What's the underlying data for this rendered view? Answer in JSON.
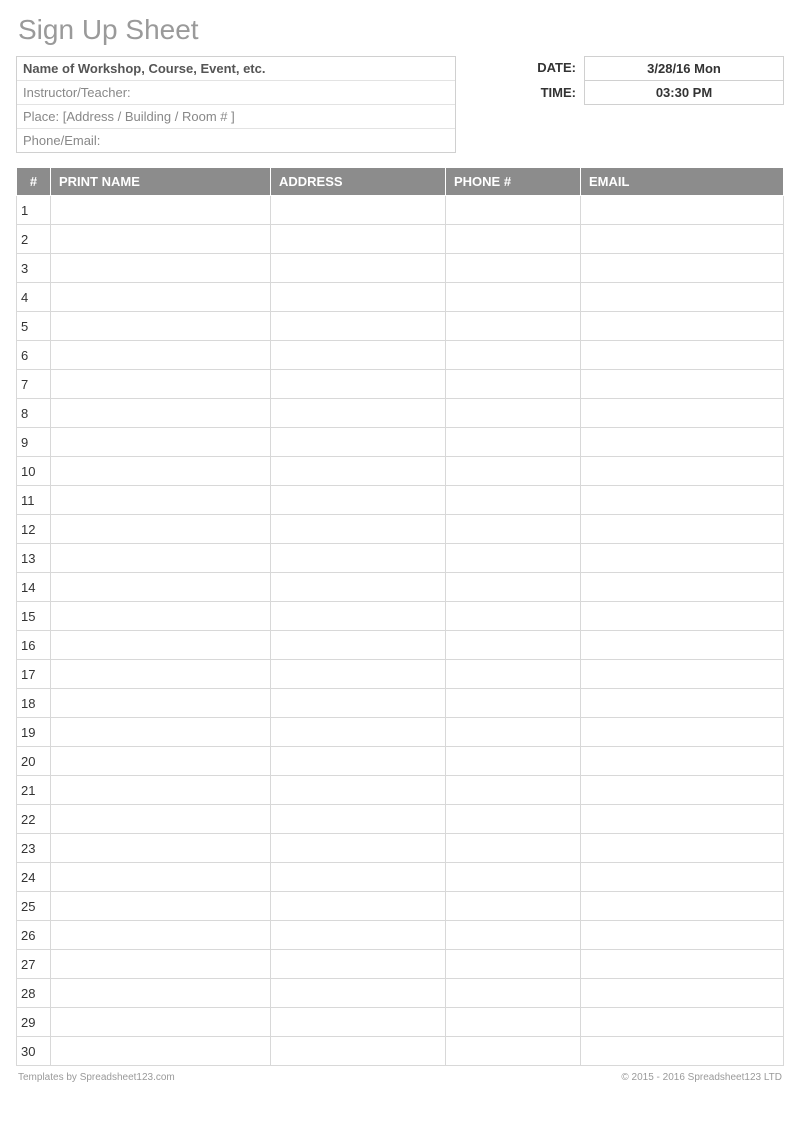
{
  "title": "Sign Up Sheet",
  "info": {
    "name": "Name of Workshop, Course, Event, etc.",
    "instructor": "Instructor/Teacher:",
    "place": "Place: [Address / Building / Room # ]",
    "phone_email": "Phone/Email:"
  },
  "meta": {
    "date_label": "DATE:",
    "date_value": "3/28/16 Mon",
    "time_label": "TIME:",
    "time_value": "03:30 PM"
  },
  "columns": {
    "num": "#",
    "print_name": "PRINT NAME",
    "address": "ADDRESS",
    "phone": "PHONE #",
    "email": "EMAIL"
  },
  "rows": [
    {
      "n": "1",
      "name": "",
      "address": "",
      "phone": "",
      "email": ""
    },
    {
      "n": "2",
      "name": "",
      "address": "",
      "phone": "",
      "email": ""
    },
    {
      "n": "3",
      "name": "",
      "address": "",
      "phone": "",
      "email": ""
    },
    {
      "n": "4",
      "name": "",
      "address": "",
      "phone": "",
      "email": ""
    },
    {
      "n": "5",
      "name": "",
      "address": "",
      "phone": "",
      "email": ""
    },
    {
      "n": "6",
      "name": "",
      "address": "",
      "phone": "",
      "email": ""
    },
    {
      "n": "7",
      "name": "",
      "address": "",
      "phone": "",
      "email": ""
    },
    {
      "n": "8",
      "name": "",
      "address": "",
      "phone": "",
      "email": ""
    },
    {
      "n": "9",
      "name": "",
      "address": "",
      "phone": "",
      "email": ""
    },
    {
      "n": "10",
      "name": "",
      "address": "",
      "phone": "",
      "email": ""
    },
    {
      "n": "11",
      "name": "",
      "address": "",
      "phone": "",
      "email": ""
    },
    {
      "n": "12",
      "name": "",
      "address": "",
      "phone": "",
      "email": ""
    },
    {
      "n": "13",
      "name": "",
      "address": "",
      "phone": "",
      "email": ""
    },
    {
      "n": "14",
      "name": "",
      "address": "",
      "phone": "",
      "email": ""
    },
    {
      "n": "15",
      "name": "",
      "address": "",
      "phone": "",
      "email": ""
    },
    {
      "n": "16",
      "name": "",
      "address": "",
      "phone": "",
      "email": ""
    },
    {
      "n": "17",
      "name": "",
      "address": "",
      "phone": "",
      "email": ""
    },
    {
      "n": "18",
      "name": "",
      "address": "",
      "phone": "",
      "email": ""
    },
    {
      "n": "19",
      "name": "",
      "address": "",
      "phone": "",
      "email": ""
    },
    {
      "n": "20",
      "name": "",
      "address": "",
      "phone": "",
      "email": ""
    },
    {
      "n": "21",
      "name": "",
      "address": "",
      "phone": "",
      "email": ""
    },
    {
      "n": "22",
      "name": "",
      "address": "",
      "phone": "",
      "email": ""
    },
    {
      "n": "23",
      "name": "",
      "address": "",
      "phone": "",
      "email": ""
    },
    {
      "n": "24",
      "name": "",
      "address": "",
      "phone": "",
      "email": ""
    },
    {
      "n": "25",
      "name": "",
      "address": "",
      "phone": "",
      "email": ""
    },
    {
      "n": "26",
      "name": "",
      "address": "",
      "phone": "",
      "email": ""
    },
    {
      "n": "27",
      "name": "",
      "address": "",
      "phone": "",
      "email": ""
    },
    {
      "n": "28",
      "name": "",
      "address": "",
      "phone": "",
      "email": ""
    },
    {
      "n": "29",
      "name": "",
      "address": "",
      "phone": "",
      "email": ""
    },
    {
      "n": "30",
      "name": "",
      "address": "",
      "phone": "",
      "email": ""
    }
  ],
  "footer": {
    "left": "Templates by Spreadsheet123.com",
    "right": "© 2015 - 2016 Spreadsheet123 LTD"
  }
}
